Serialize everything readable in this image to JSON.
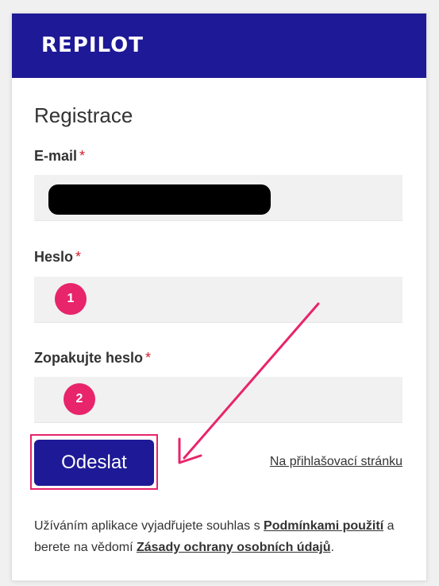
{
  "header": {
    "logo_text": "REPILOT",
    "background": "#1e1996"
  },
  "form": {
    "title": "Registrace",
    "required_marker": "*",
    "email": {
      "label": "E-mail",
      "value": ""
    },
    "password": {
      "label": "Heslo",
      "value": ""
    },
    "password_repeat": {
      "label": "Zopakujte heslo",
      "value": ""
    },
    "submit_label": "Odeslat",
    "login_link": "Na přihlašovací stránku"
  },
  "consent": {
    "text_before": "Užíváním aplikace vyjadřujete souhlas s ",
    "terms_link": "Podmínkami použití",
    "text_middle": " a berete na vědomí ",
    "privacy_link": "Zásady ochrany osobních údajů",
    "text_after": "."
  },
  "annotations": {
    "badge_1": "1",
    "badge_2": "2",
    "accent": "#e8246a"
  }
}
